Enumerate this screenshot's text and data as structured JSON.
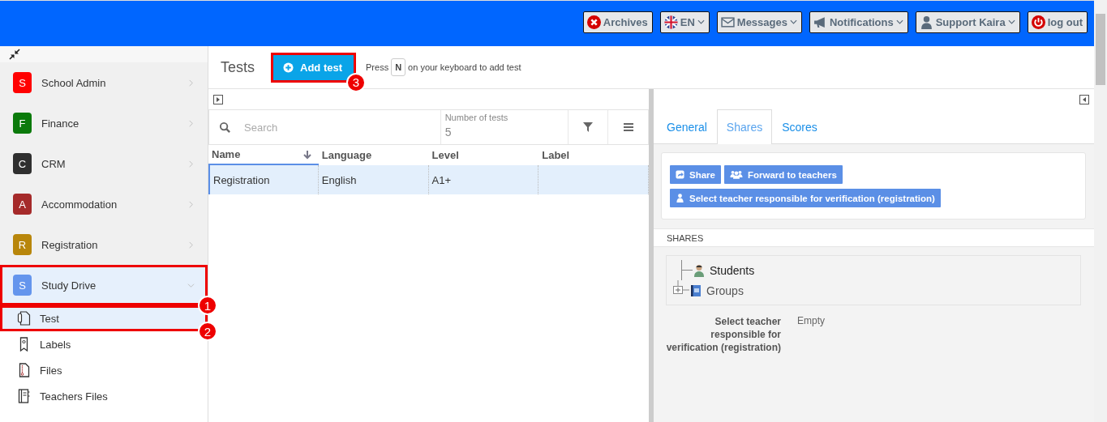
{
  "top_bar": {
    "buttons": [
      {
        "label": "Archives",
        "dropdown": false
      },
      {
        "label": "EN",
        "dropdown": true
      },
      {
        "label": "Messages",
        "dropdown": true
      },
      {
        "label": "Notifications",
        "dropdown": true
      },
      {
        "label": "Support Kaira",
        "dropdown": true
      },
      {
        "label": "log out",
        "dropdown": false
      }
    ]
  },
  "sidebar": {
    "modules": [
      {
        "letter": "S",
        "label": "School Admin",
        "color": "#ff0000",
        "expanded": false,
        "selected": false
      },
      {
        "letter": "F",
        "label": "Finance",
        "color": "#0b7a0b",
        "expanded": false,
        "selected": false
      },
      {
        "letter": "C",
        "label": "CRM",
        "color": "#2f2f2f",
        "expanded": false,
        "selected": false
      },
      {
        "letter": "A",
        "label": "Accommodation",
        "color": "#a52a2a",
        "expanded": false,
        "selected": false
      },
      {
        "letter": "R",
        "label": "Registration",
        "color": "#b8860b",
        "expanded": false,
        "selected": false
      },
      {
        "letter": "S",
        "label": "Study Drive",
        "color": "#6495ed",
        "expanded": true,
        "selected": true,
        "callout": "1"
      }
    ],
    "items": [
      {
        "label": "Test",
        "selected": true,
        "callout": "2"
      },
      {
        "label": "Labels",
        "selected": false
      },
      {
        "label": "Files",
        "selected": false
      },
      {
        "label": "Teachers Files",
        "selected": false
      }
    ]
  },
  "header": {
    "title": "Tests",
    "add_button": {
      "label": "Add test",
      "callout": "3"
    },
    "hint_before": "Press",
    "hint_key": "N",
    "hint_after": "on your keyboard to add test"
  },
  "table": {
    "search": {
      "placeholder": "Search"
    },
    "count_label": "Number of tests",
    "count": "5",
    "columns": [
      {
        "label": "Name",
        "sorted": true
      },
      {
        "label": "Language",
        "sorted": false
      },
      {
        "label": "Level",
        "sorted": false
      },
      {
        "label": "Label",
        "sorted": false
      }
    ],
    "rows": [
      {
        "name": "Registration",
        "language": "English",
        "level": "A1+",
        "selected": true
      }
    ]
  },
  "detail": {
    "tabs": [
      {
        "label": "General",
        "selected": false
      },
      {
        "label": "Shares",
        "selected": true
      },
      {
        "label": "Scores",
        "selected": false
      }
    ],
    "actions": [
      "Share",
      "Forward to teachers",
      "Select teacher responsible for verification (registration)"
    ],
    "section_title": "SHARES",
    "tree": [
      {
        "label": "Students",
        "expandable": false
      },
      {
        "label": "Groups",
        "expandable": true
      }
    ],
    "field": {
      "label": "Select teacher responsible for verification (registration)",
      "value": "Empty"
    }
  }
}
